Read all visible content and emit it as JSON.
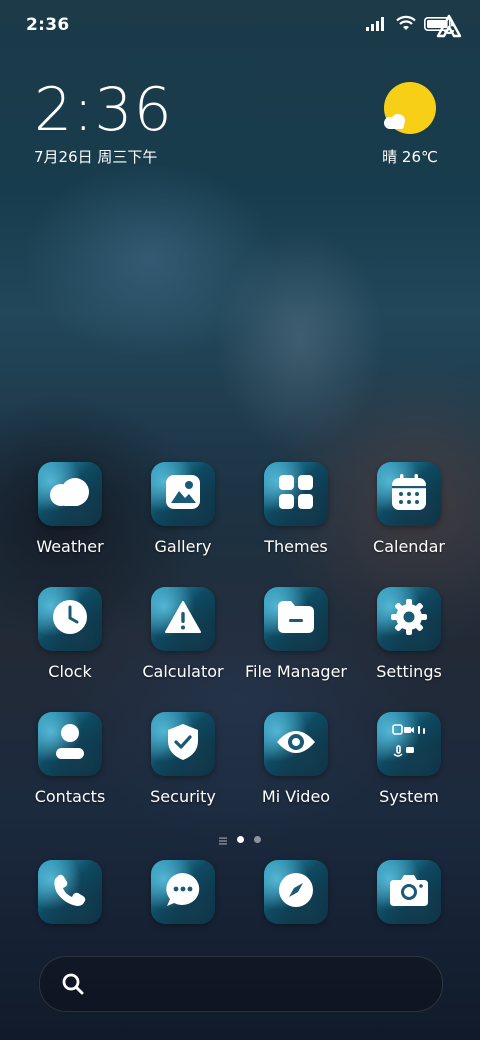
{
  "status_bar": {
    "time": "2:36",
    "icons": [
      "signal-icon",
      "wifi-icon",
      "battery-icon"
    ]
  },
  "clock_widget": {
    "time": "2:36",
    "date": "7月26日 周三下午"
  },
  "weather_widget": {
    "condition_icon": "sunny-cloud-icon",
    "text": "晴 26℃",
    "sun_color": "#f7cf17"
  },
  "apps": [
    {
      "label": "Weather",
      "icon": "cloud-icon"
    },
    {
      "label": "Gallery",
      "icon": "image-icon"
    },
    {
      "label": "Themes",
      "icon": "grid-icon"
    },
    {
      "label": "Calendar",
      "icon": "calendar-icon"
    },
    {
      "label": "Clock",
      "icon": "clock-icon"
    },
    {
      "label": "Calculator",
      "icon": "warning-icon"
    },
    {
      "label": "File Manager",
      "icon": "folder-icon"
    },
    {
      "label": "Settings",
      "icon": "gear-icon"
    },
    {
      "label": "Contacts",
      "icon": "person-icon"
    },
    {
      "label": "Security",
      "icon": "shield-icon"
    },
    {
      "label": "Mi Video",
      "icon": "eye-icon"
    },
    {
      "label": "System",
      "icon": "folder-grid-icon"
    }
  ],
  "page_indicator": {
    "pages": 2,
    "current": 1
  },
  "dock": [
    {
      "name": "phone",
      "icon": "phone-icon"
    },
    {
      "name": "messages",
      "icon": "chat-icon"
    },
    {
      "name": "browser",
      "icon": "compass-icon"
    },
    {
      "name": "camera",
      "icon": "camera-icon"
    }
  ],
  "search_bar": {
    "left_icon": "search-icon",
    "right_icon": "assistant-icon"
  }
}
